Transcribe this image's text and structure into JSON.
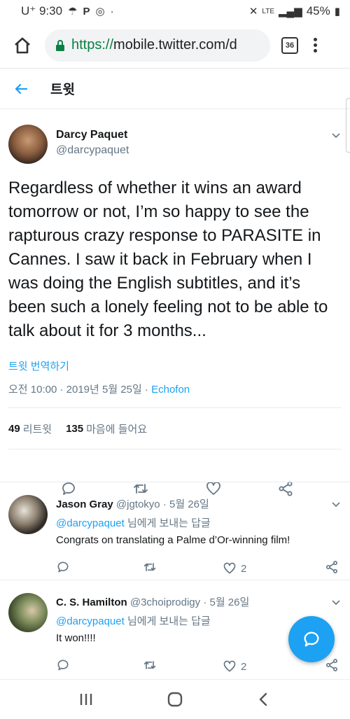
{
  "statusbar": {
    "carrier": "U⁺ 9:30",
    "network": "LTE",
    "battery": "45%"
  },
  "browser": {
    "url_scheme": "https://",
    "url_rest": "mobile.twitter.com/d",
    "tab_count": "36"
  },
  "header": {
    "title": "트윗"
  },
  "tweet": {
    "author_name": "Darcy Paquet",
    "author_handle": "@darcypaquet",
    "text": "Regardless of whether it wins an award tomorrow or not, I’m so happy to see the rapturous crazy response to PARASITE in Cannes. I saw it back in February when I was doing the English subtitles, and it’s been such a lonely feeling not to be able to talk about it for 3 months...",
    "translate_label": "트윗 번역하기",
    "timestamp": "오전 10:00 · 2019년 5월 25일 · ",
    "via": "Echofon",
    "retweets_count": "49",
    "retweets_label": "리트윗",
    "likes_count": "135",
    "likes_label": "마음에 들어요"
  },
  "replies": [
    {
      "name": "Jason Gray",
      "handle": "@jgtokyo",
      "date": " · 5월 26일",
      "reply_to_mention": "@darcypaquet",
      "reply_to_suffix": " 님에게 보내는 답글",
      "text": "Congrats on translating a Palme d’Or-winning film!",
      "likes": "2"
    },
    {
      "name": "C. S. Hamilton",
      "handle": "@3choiprodigy",
      "date": " · 5월 26일",
      "reply_to_mention": "@darcypaquet",
      "reply_to_suffix": " 님에게 보내는 답글",
      "text": "It won!!!!",
      "likes": "2"
    }
  ],
  "colors": {
    "accent": "#1da1f2",
    "secondary_text": "#657786",
    "url_green": "#0b8043"
  }
}
